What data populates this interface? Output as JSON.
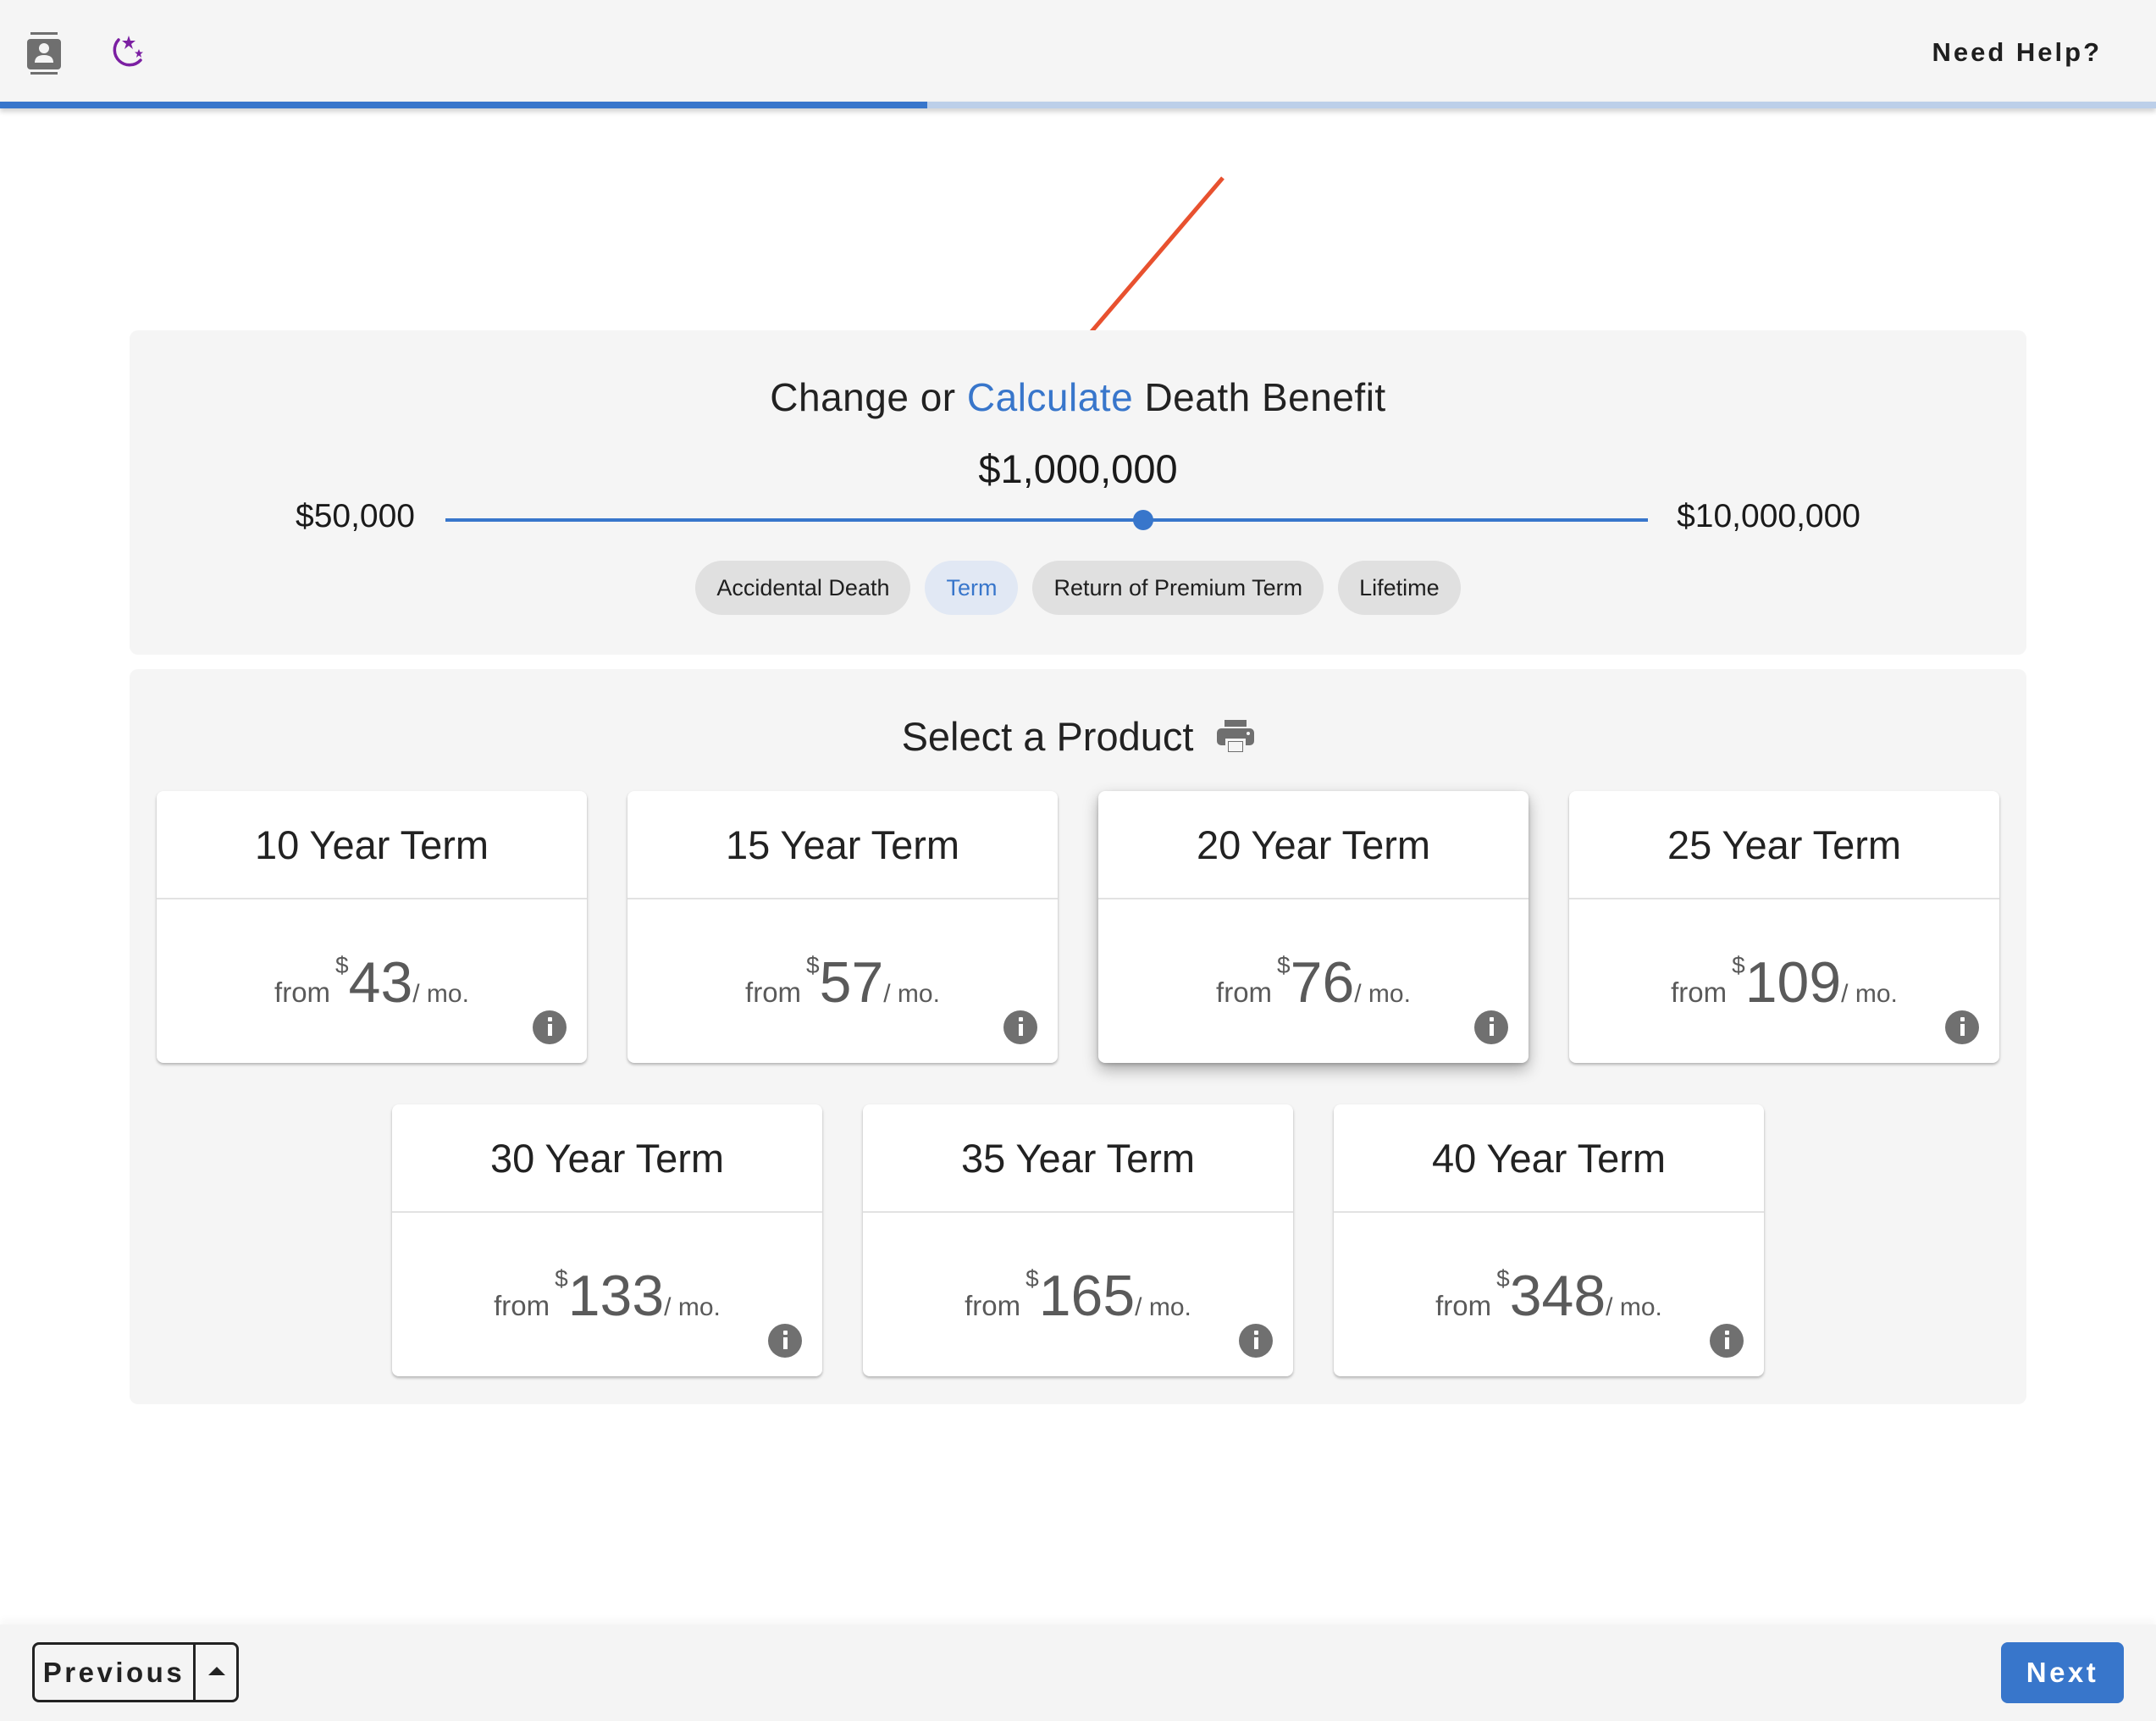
{
  "header": {
    "icons": [
      "contact-icon",
      "night-mode-icon"
    ],
    "help_label": "Need Help?",
    "progress_percent": 43,
    "colors": {
      "accent": "#3876cb",
      "progress_track": "#bccfe9",
      "night_icon": "#7b1fa2"
    }
  },
  "annotation": {
    "type": "arrow",
    "color": "#e8512f",
    "points_to": "Calculate"
  },
  "benefit": {
    "title_prefix": "Change or ",
    "title_link": "Calculate",
    "title_suffix": " Death Benefit",
    "amount": "$1,000,000",
    "min_label": "$50,000",
    "max_label": "$10,000,000",
    "slider_position_percent": 58,
    "chips": [
      {
        "label": "Accidental Death",
        "active": false
      },
      {
        "label": "Term",
        "active": true
      },
      {
        "label": "Return of Premium Term",
        "active": false
      },
      {
        "label": "Lifetime",
        "active": false
      }
    ]
  },
  "products": {
    "title": "Select a Product",
    "print_icon": "print-icon",
    "from_label": "from",
    "currency": "$",
    "per_label": "/ mo.",
    "info_icon": "info-icon",
    "items": [
      {
        "name": "10 Year Term",
        "price": "43",
        "raised": false
      },
      {
        "name": "15 Year Term",
        "price": "57",
        "raised": false
      },
      {
        "name": "20 Year Term",
        "price": "76",
        "raised": true
      },
      {
        "name": "25 Year Term",
        "price": "109",
        "raised": false
      },
      {
        "name": "30 Year Term",
        "price": "133",
        "raised": false
      },
      {
        "name": "35 Year Term",
        "price": "165",
        "raised": false
      },
      {
        "name": "40 Year Term",
        "price": "348",
        "raised": false
      }
    ]
  },
  "footer": {
    "previous_label": "Previous",
    "previous_menu_icon": "caret-up-icon",
    "next_label": "Next"
  }
}
